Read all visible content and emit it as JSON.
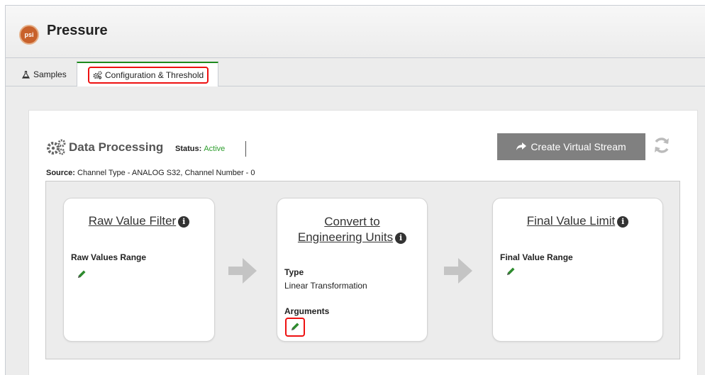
{
  "header": {
    "logo_text": "psi",
    "title": "Pressure"
  },
  "tabs": [
    {
      "label": "Samples",
      "icon": "flask-icon"
    },
    {
      "label": "Configuration & Threshold",
      "icon": "gears-icon",
      "active": true
    }
  ],
  "processing": {
    "title": "Data Processing",
    "status_label": "Status:",
    "status_value": "Active",
    "create_button_label": "Create Virtual Stream",
    "source_label": "Source:",
    "source_value": "Channel Type - ANALOG S32, Channel Number - 0"
  },
  "cards": {
    "raw": {
      "title": "Raw Value Filter",
      "range_label": "Raw Values Range"
    },
    "convert": {
      "title_line1": "Convert to",
      "title_line2": "Engineering Units",
      "type_label": "Type",
      "type_value": "Linear Transformation",
      "args_label": "Arguments"
    },
    "final": {
      "title": "Final Value Limit",
      "range_label": "Final Value Range"
    }
  },
  "colors": {
    "status_active": "#2e9e2e",
    "highlight": "#ee1111",
    "pencil": "#2e8b2e",
    "tab_accent": "#1e8a1e"
  }
}
